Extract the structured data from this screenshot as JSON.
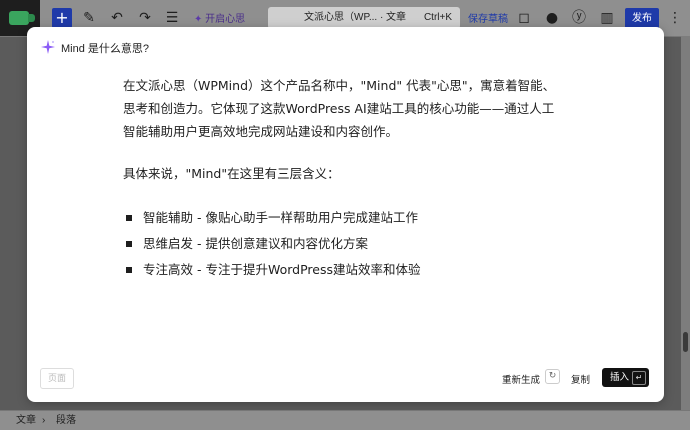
{
  "toolbar": {
    "add_icon": "+",
    "mind_label": "开启心思",
    "doc_title": "文派心思（WP...",
    "doc_type": "· 文章",
    "shortcut": "Ctrl+K",
    "save_draft": "保存草稿",
    "publish": "发布"
  },
  "modal": {
    "query": "Mind 是什么意思?",
    "paragraph1": "在文派心思（WPMind）这个产品名称中，\"Mind\" 代表\"心思\"，寓意着智能、思考和创造力。它体现了这款WordPress AI建站工具的核心功能——通过人工智能辅助用户更高效地完成网站建设和内容创作。",
    "paragraph2": "具体来说，\"Mind\"在这里有三层含义：",
    "bullets": [
      "智能辅助 - 像贴心助手一样帮助用户完成建站工作",
      "思维启发 - 提供创意建议和内容优化方案",
      "专注高效 - 专注于提升WordPress建站效率和体验"
    ],
    "page_button": "页面",
    "regenerate": "重新生成",
    "copy": "复制",
    "insert": "插入"
  },
  "breadcrumb": {
    "item1": "文章",
    "separator": "›",
    "item2": "段落"
  },
  "colors": {
    "publish_bg": "#1f3aa9",
    "sparkle": "#8b5cf6",
    "insert_bg": "#111111"
  },
  "icons": [
    "wordpress-logo-icon",
    "pen-icon",
    "undo-icon",
    "redo-icon",
    "list-view-icon",
    "sparkle-icon",
    "bell-icon",
    "chat-icon",
    "yoast-icon",
    "sidebar-toggle-icon",
    "more-icon"
  ]
}
